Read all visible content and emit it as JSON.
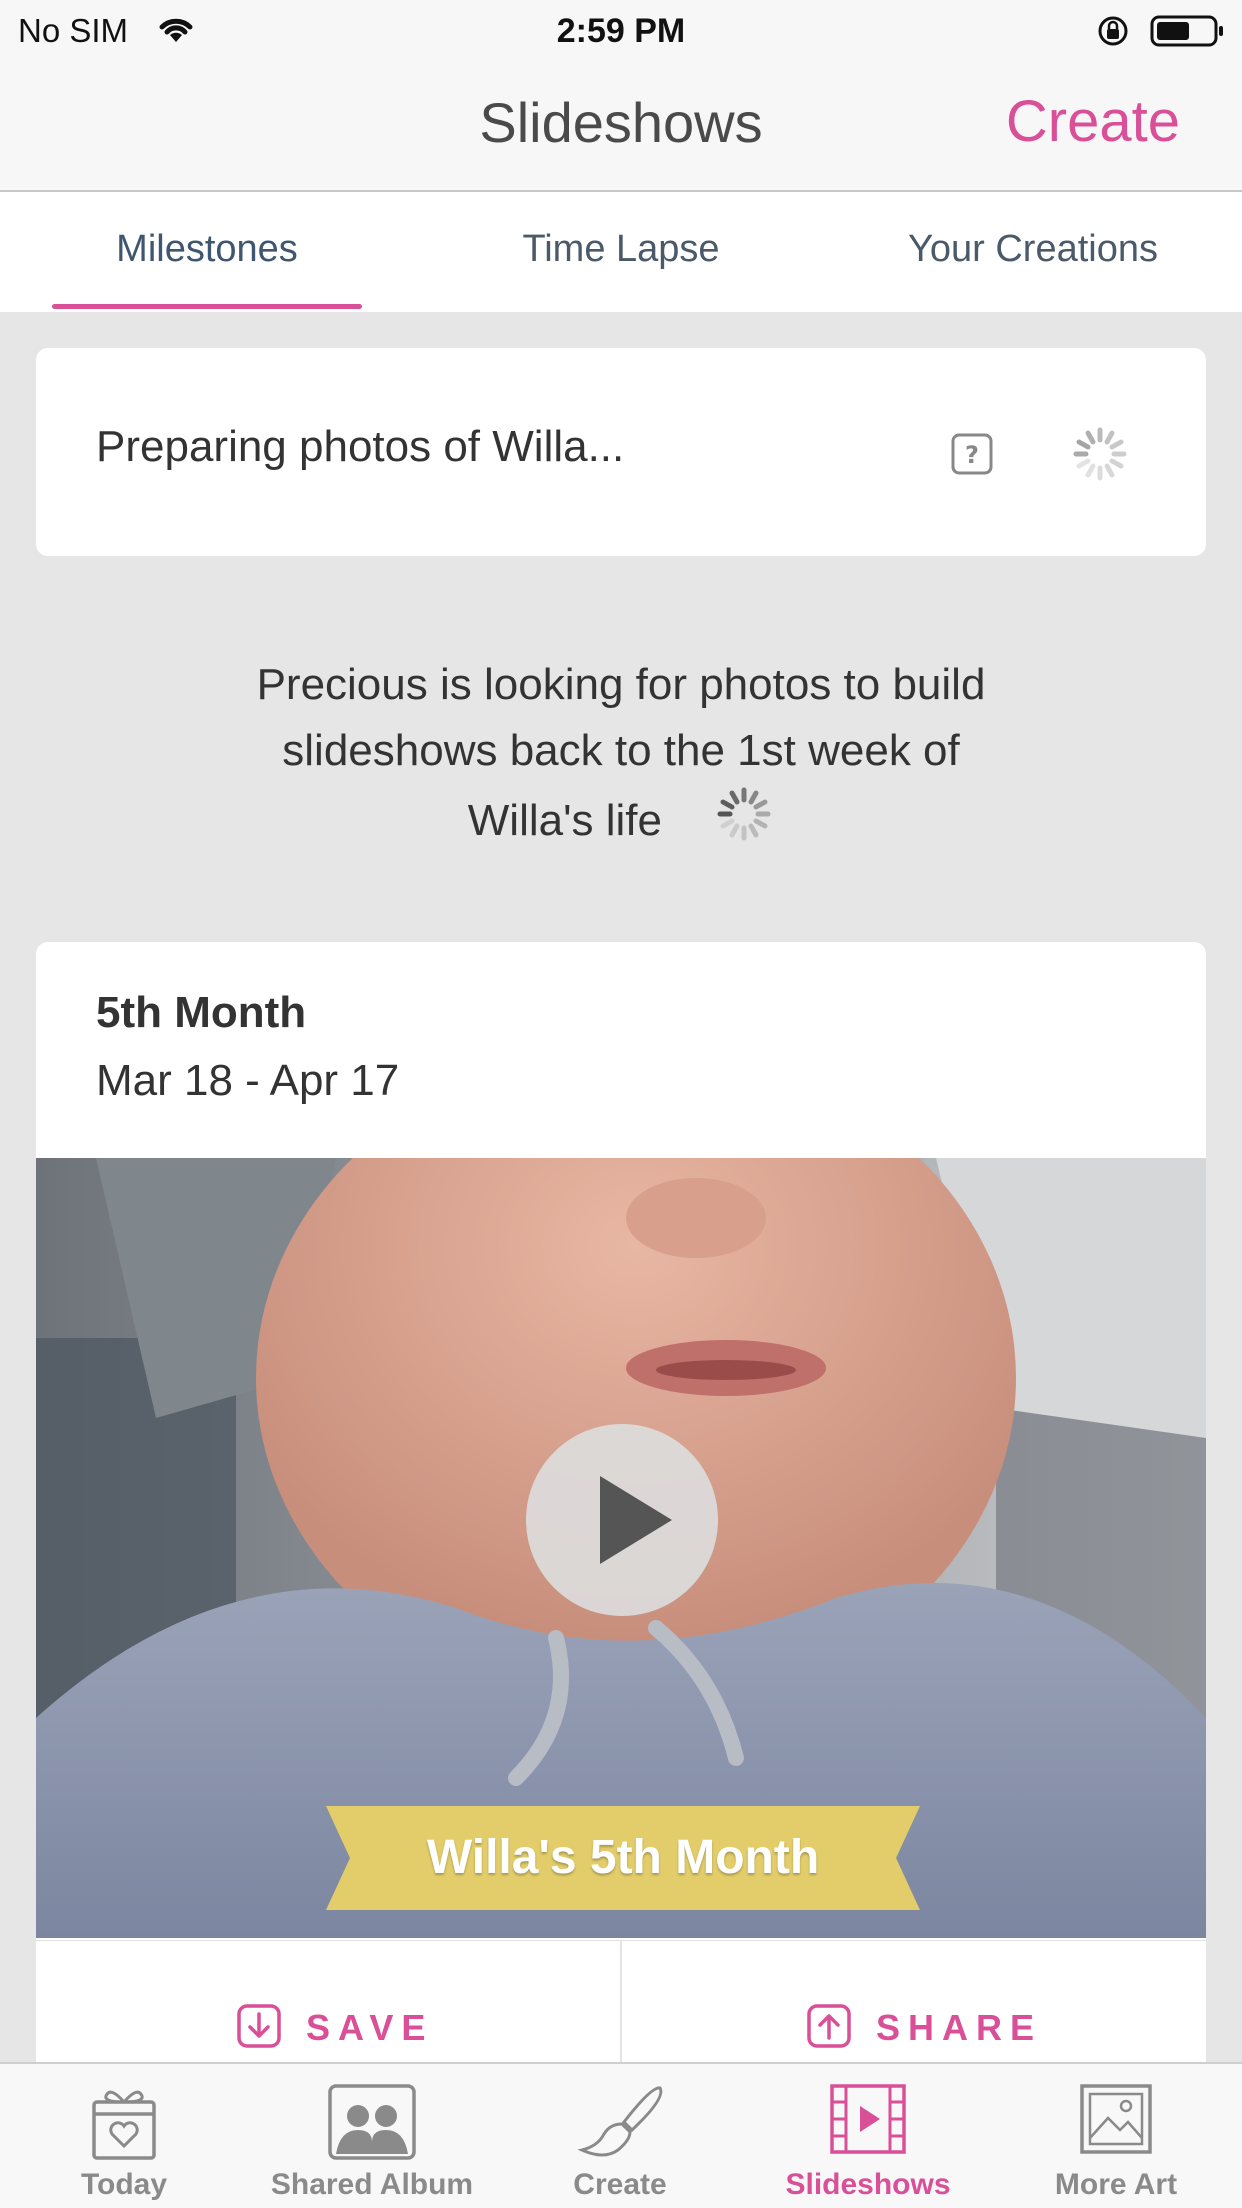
{
  "status_bar": {
    "carrier": "No SIM",
    "time": "2:59 PM",
    "wifi_icon": "wifi-icon",
    "lock_icon": "rotation-lock-icon",
    "battery_icon": "battery-icon"
  },
  "nav": {
    "title": "Slideshows",
    "create_label": "Create"
  },
  "tabs": [
    {
      "label": "Milestones",
      "selected": true
    },
    {
      "label": "Time Lapse",
      "selected": false
    },
    {
      "label": "Your Creations",
      "selected": false
    }
  ],
  "preparing": {
    "text": "Preparing photos of Willa...",
    "help_icon": "question-mark-icon",
    "spinner_icon": "loading-spinner-icon"
  },
  "looking_message": {
    "line1": "Precious is looking for photos to build",
    "line2": "slideshows back to the 1st week of",
    "line3": "Willa's life"
  },
  "milestone": {
    "title": "5th Month",
    "dates": "Mar 18 - Apr 17",
    "ribbon_text": "Willa's 5th Month",
    "play_icon": "play-icon",
    "save_label": "SAVE",
    "share_label": "SHARE"
  },
  "tab_bar": [
    {
      "label": "Today",
      "icon": "gift-heart-icon",
      "active": false
    },
    {
      "label": "Shared Album",
      "icon": "people-photo-icon",
      "active": false
    },
    {
      "label": "Create",
      "icon": "paintbrush-icon",
      "active": false
    },
    {
      "label": "Slideshows",
      "icon": "film-play-icon",
      "active": true
    },
    {
      "label": "More Art",
      "icon": "picture-frame-icon",
      "active": false
    }
  ],
  "colors": {
    "accent": "#d94f98",
    "ribbon": "#e2cd6a",
    "background": "#e6e6e6"
  }
}
